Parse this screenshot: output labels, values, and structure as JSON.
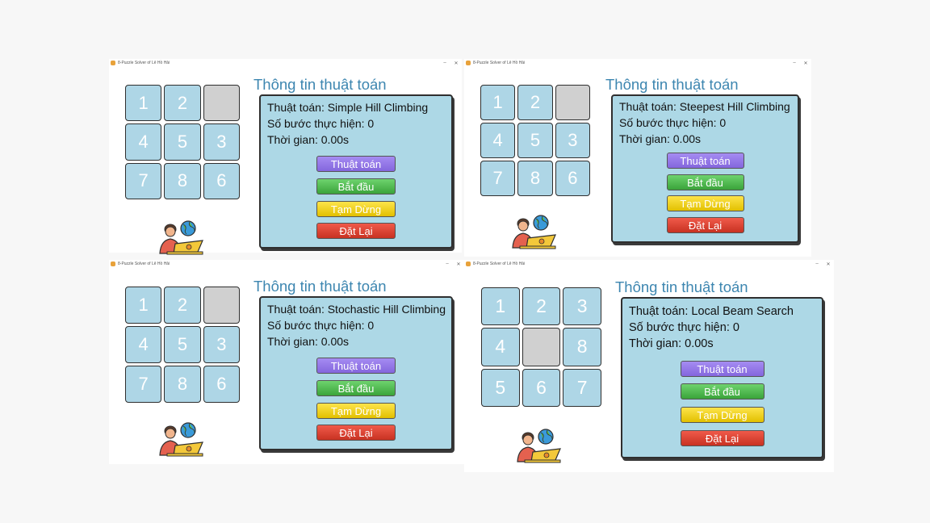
{
  "labels": {
    "info_title": "Thông tin thuật toán",
    "steps": "Số bước thực hiện: 0",
    "time": "Thời gian: 0.00s",
    "btn_algorithm": "Thuật toán",
    "btn_start": "Bắt đầu",
    "btn_pause": "Tạm Dừng",
    "btn_reset": "Đặt Lại"
  },
  "windows": [
    {
      "window_title": "8-Puzzle Solver of Lê Hồ Hải",
      "algorithm": "Thuật toán: Simple Hill Climbing",
      "tiles": [
        "1",
        "2",
        "",
        "4",
        "5",
        "3",
        "7",
        "8",
        "6"
      ]
    },
    {
      "window_title": "8-Puzzle Solver of Lê Hồ Hải",
      "algorithm": "Thuật toán: Steepest Hill Climbing",
      "tiles": [
        "1",
        "2",
        "",
        "4",
        "5",
        "3",
        "7",
        "8",
        "6"
      ]
    },
    {
      "window_title": "8-Puzzle Solver of Lê Hồ Hải",
      "algorithm": "Thuật toán: Stochastic Hill Climbing",
      "tiles": [
        "1",
        "2",
        "",
        "4",
        "5",
        "3",
        "7",
        "8",
        "6"
      ]
    },
    {
      "window_title": "8-Puzzle Solver of Lê Hồ Hải",
      "algorithm": "Thuật toán: Local Beam Search",
      "tiles": [
        "1",
        "2",
        "3",
        "4",
        "",
        "8",
        "5",
        "6",
        "7"
      ]
    }
  ],
  "colors": {
    "tile": "#aed6e6",
    "empty_tile": "#d0d0d0",
    "panel": "#add8e6",
    "title_blue": "#3d86b0",
    "btn_algorithm": "#8c6fe3",
    "btn_start": "#4cb84c",
    "btn_pause": "#f0d21c",
    "btn_reset": "#d83f2f"
  },
  "icons": [
    "app-icon",
    "minimize-icon",
    "close-icon",
    "developer-avatar-icon",
    "globe-icon",
    "laptop-icon"
  ]
}
